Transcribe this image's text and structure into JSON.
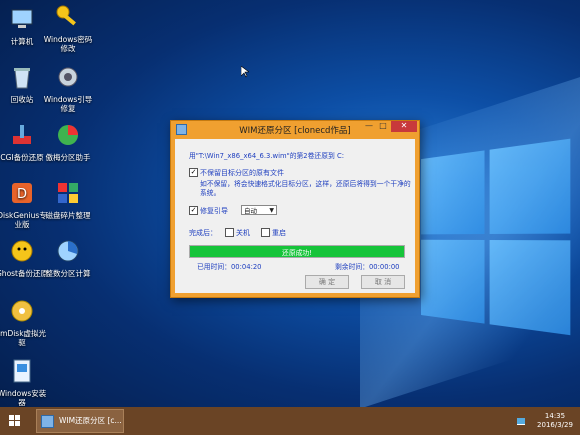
{
  "desktop": {
    "icons": [
      {
        "label": "计算机"
      },
      {
        "label": "Windows密码修改"
      },
      {
        "label": "回收站"
      },
      {
        "label": "Windows引导修复"
      },
      {
        "label": "CGI备份还原"
      },
      {
        "label": "傲梅分区助手"
      },
      {
        "label": "DiskGenius专业版"
      },
      {
        "label": "磁盘碎片整理"
      },
      {
        "label": "Ghost备份还原"
      },
      {
        "label": "整数分区计算"
      },
      {
        "label": "ImDisk虚拟光驱"
      },
      {
        "label": "Windows安装器"
      }
    ]
  },
  "dialog": {
    "title": "WIM还原分区  [clonecd作品]",
    "minimize": "—",
    "maximize": "□",
    "close": "✕",
    "restore_line": "用\"T:\\Win7_x86_x64_6.3.wim\"的第2卷还原到 C:",
    "option_keep": {
      "label": "不保留目标分区的原有文件",
      "checked": "✓"
    },
    "note_line1": "如不保留，将会快速格式化目标分区，这样，还原后将得到一个干净的",
    "note_line2": "系统。",
    "option_repair": {
      "label": "修复引导",
      "checked": "✓"
    },
    "boot_mode": "自动",
    "after_label": "完成后：",
    "shutdown_label": "关机",
    "restart_label": "重启",
    "progress": {
      "text": "还原成功!",
      "percent": 100
    },
    "elapsed": "已用时间：00:04:20",
    "remaining": "剩余时间：00:00:00",
    "ok_button": "确 定",
    "cancel_button": "取 消"
  },
  "taskbar": {
    "task_label": "WIM还原分区  [c...",
    "clock_time": "14:35",
    "clock_date": "2016/3/29"
  },
  "colors": {
    "dialog_frame": "#f0a030",
    "progress_fill": "#16c43a",
    "text_blue": "#1f3fbf",
    "taskbar": "#6a4425"
  }
}
